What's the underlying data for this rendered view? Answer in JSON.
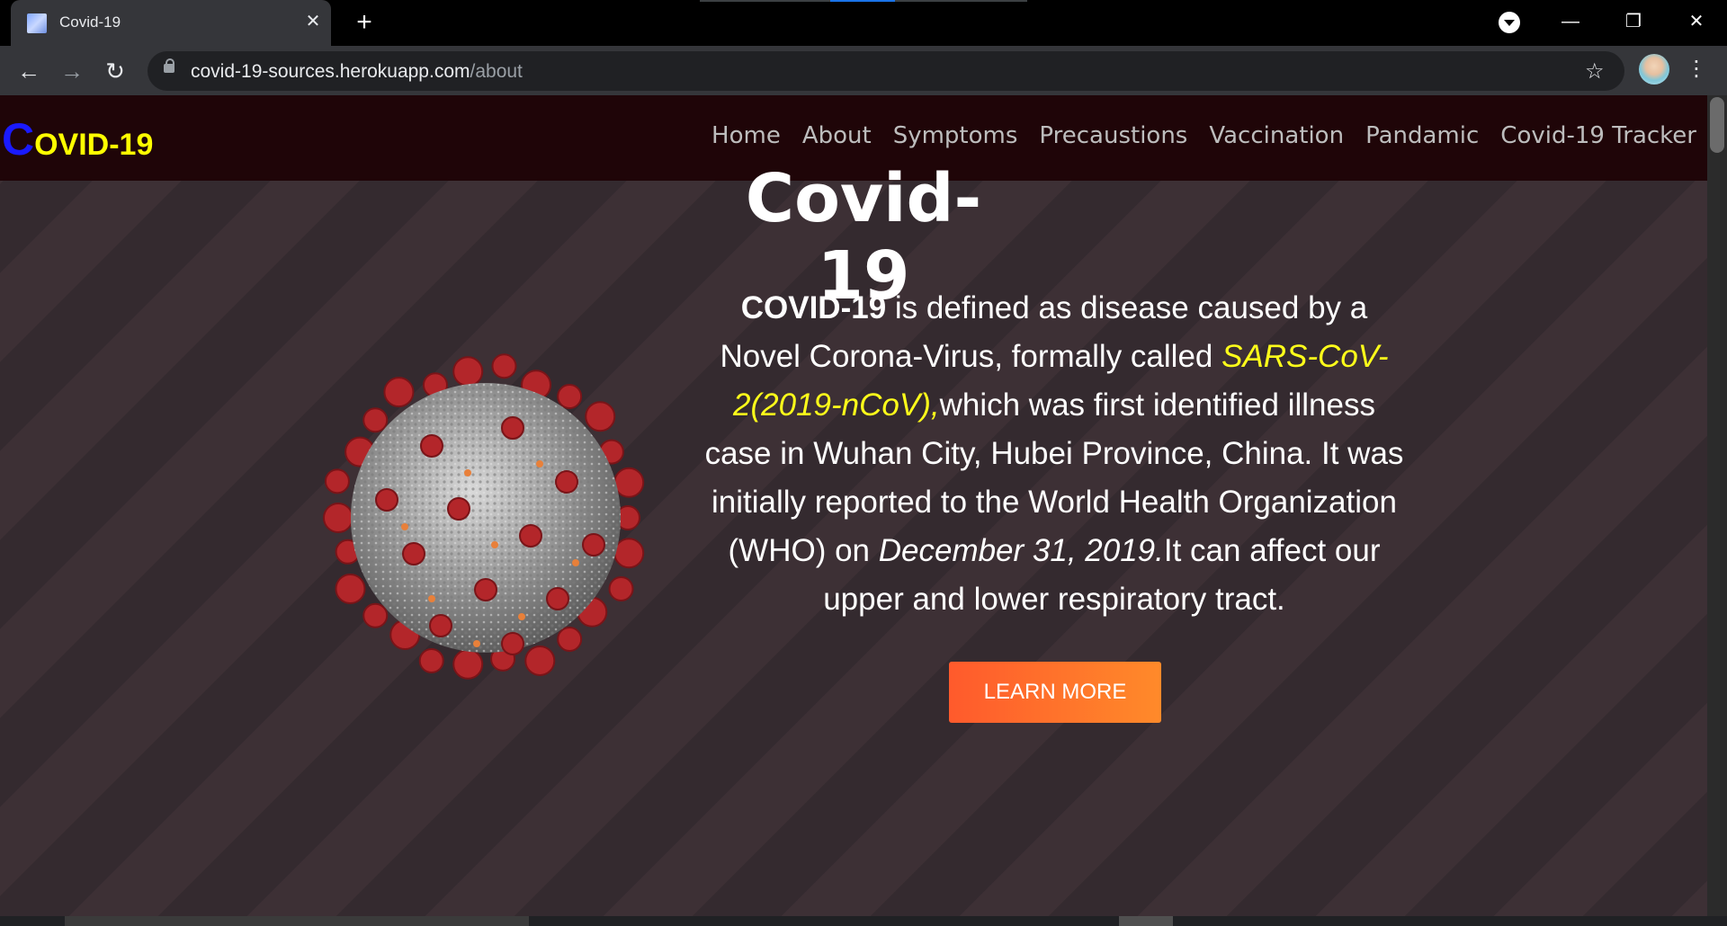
{
  "browser": {
    "tab_title": "Covid-19",
    "tab_close": "✕",
    "new_tab": "+",
    "url_host": "covid-19-sources.herokuapp.com",
    "url_path": "/about",
    "minimize": "—",
    "restore": "❐",
    "close": "✕",
    "back": "←",
    "forward": "→",
    "reload": "↻",
    "star": "☆",
    "menu": "⋮"
  },
  "site": {
    "logo_first": "C",
    "logo_rest": "OVID-19",
    "nav": [
      "Home",
      "About",
      "Symptoms",
      "Precaustions",
      "Vaccination",
      "Pandamic",
      "Covid-19 Tracker"
    ]
  },
  "hero": {
    "title": "Covid-19",
    "desc_bold": "COVID-19",
    "desc_part1": " is defined as disease caused by a Novel Corona-Virus, formally called ",
    "desc_virus": "SARS-CoV-2(2019-nCoV),",
    "desc_part2": "which was first identified illness case in Wuhan City, Hubei Province, China. It was initially reported to the World Health Organization (WHO) on ",
    "desc_date": "December 31, 2019.",
    "desc_part3": "It can affect our upper and lower respiratory tract.",
    "button": "LEARN MORE"
  },
  "colors": {
    "logo_c": "#1a1aff",
    "logo_text": "#ffff00",
    "virus_name": "#ffff1a",
    "button_start": "#ff5a2c",
    "button_end": "#ff8a2a"
  }
}
